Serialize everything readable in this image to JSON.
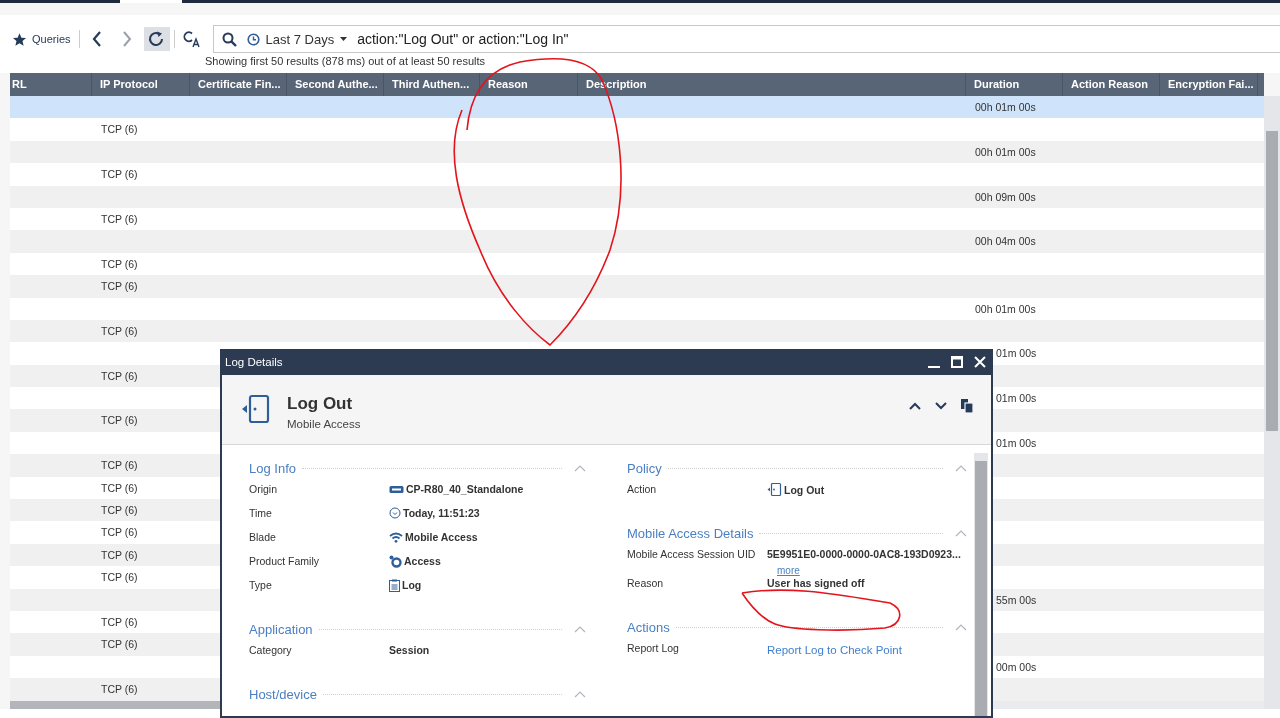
{
  "toolbar": {
    "queries_label": "Queries",
    "time_range": "Last 7 Days",
    "query": "action:\"Log Out\" or action:\"Log In\"",
    "summary": "Showing first 50 results (878 ms) out of at least 50 results"
  },
  "table": {
    "columns": [
      "RL",
      "IP Protocol",
      "Certificate Fin...",
      "Second Authe...",
      "Third Authen...",
      "Reason",
      "Description",
      "Duration",
      "Action Reason",
      "Encryption Fai..."
    ],
    "rows": [
      {
        "selected": true,
        "duration": "00h 01m 00s"
      },
      {
        "selected": false,
        "protocol": "TCP (6)"
      },
      {
        "selected": false,
        "duration": "00h 01m 00s"
      },
      {
        "selected": false,
        "protocol": "TCP (6)"
      },
      {
        "selected": false,
        "duration": "00h 09m 00s"
      },
      {
        "selected": false,
        "protocol": "TCP (6)"
      },
      {
        "selected": false,
        "duration": "00h 04m 00s"
      },
      {
        "selected": false,
        "protocol": "TCP (6)"
      },
      {
        "selected": false,
        "protocol": "TCP (6)"
      },
      {
        "selected": false,
        "duration": "00h 01m 00s"
      },
      {
        "selected": false,
        "protocol": "TCP (6)"
      },
      {
        "selected": false,
        "duration": "01m 00s",
        "partly_hidden": true
      },
      {
        "selected": false,
        "protocol": "TCP (6)"
      },
      {
        "selected": false,
        "duration": "01m 00s",
        "partly_hidden": true
      },
      {
        "selected": false,
        "protocol": "TCP (6)"
      },
      {
        "selected": false,
        "duration": "01m 00s",
        "partly_hidden": true
      },
      {
        "selected": false,
        "protocol": "TCP (6)"
      },
      {
        "selected": false,
        "protocol": "TCP (6)"
      },
      {
        "selected": false,
        "protocol": "TCP (6)"
      },
      {
        "selected": false,
        "protocol": "TCP (6)"
      },
      {
        "selected": false,
        "protocol": "TCP (6)"
      },
      {
        "selected": false,
        "protocol": "TCP (6)"
      },
      {
        "selected": false,
        "duration": "55m 00s",
        "partly_hidden": true
      },
      {
        "selected": false,
        "protocol": "TCP (6)"
      },
      {
        "selected": false,
        "protocol": "TCP (6)"
      },
      {
        "selected": false,
        "duration": "00m 00s",
        "partly_hidden": true
      },
      {
        "selected": false,
        "protocol": "TCP (6)"
      }
    ]
  },
  "dialog": {
    "title": "Log Details",
    "heading": "Log Out",
    "subheading": "Mobile Access",
    "left_sections": [
      {
        "title": "Log Info",
        "expanded": true,
        "fields": [
          {
            "label": "Origin",
            "value": "CP-R80_40_Standalone",
            "kind": "server"
          },
          {
            "label": "Time",
            "value": "Today, 11:51:23",
            "kind": "clock"
          },
          {
            "label": "Blade",
            "value": "Mobile Access",
            "kind": "wifi"
          },
          {
            "label": "Product Family",
            "value": "Access",
            "kind": "access"
          },
          {
            "label": "Type",
            "value": "Log",
            "kind": "document"
          }
        ]
      },
      {
        "title": "Application",
        "expanded": true,
        "fields": [
          {
            "label": "Category",
            "value": "Session",
            "kind": "plain"
          }
        ]
      },
      {
        "title": "Host/device",
        "expanded": true
      }
    ],
    "right_sections": [
      {
        "title": "Policy",
        "expanded": true,
        "fields": [
          {
            "label": "Action",
            "value": "Log Out",
            "kind": "door"
          }
        ]
      },
      {
        "title": "Mobile Access Details",
        "expanded": true,
        "fields": [
          {
            "label": "Mobile Access Session UID",
            "value": "5E9951E0-0000-0000-0AC8-193D0923...",
            "kind": "plain",
            "more": "more"
          },
          {
            "label": "Reason",
            "value": "User has signed off",
            "kind": "plain"
          }
        ]
      },
      {
        "title": "Actions",
        "expanded": true,
        "fields": [
          {
            "label": "Report Log",
            "value": "Report Log to Check Point",
            "kind": "link"
          }
        ]
      }
    ]
  }
}
